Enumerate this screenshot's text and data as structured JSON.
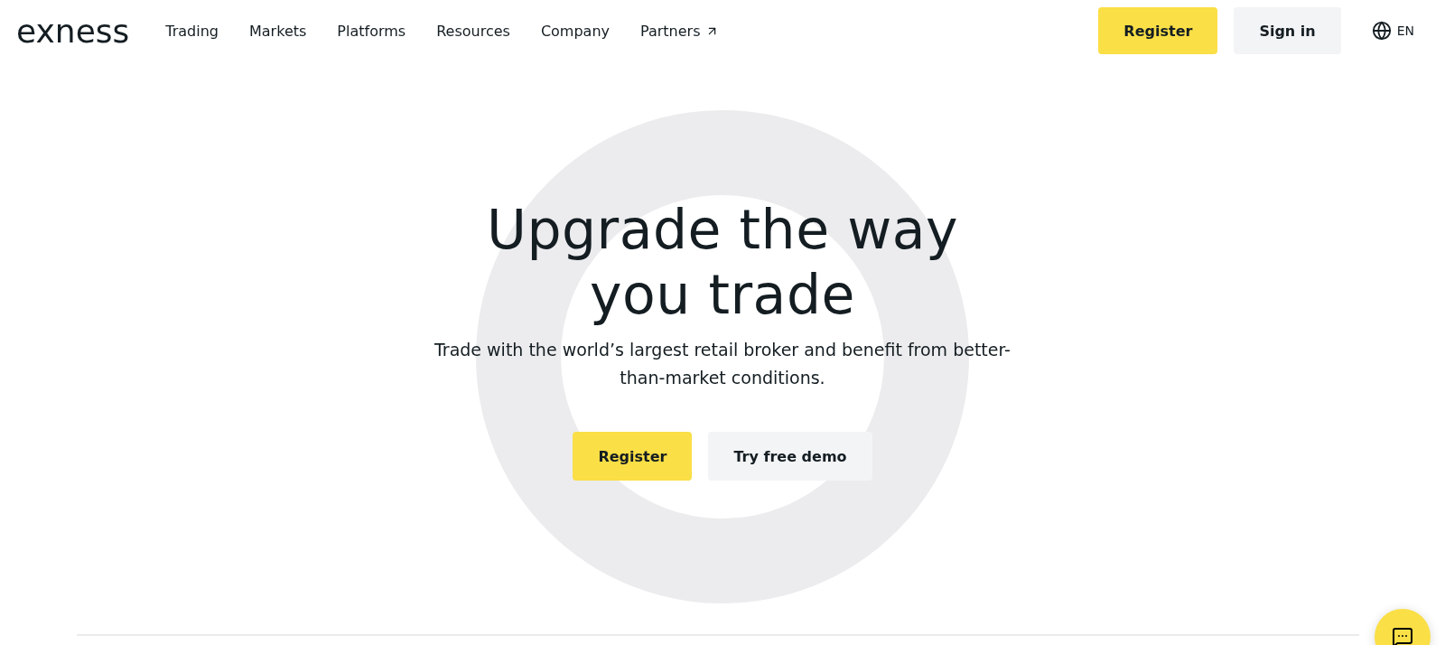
{
  "header": {
    "logo": "exness",
    "nav": [
      {
        "label": "Trading",
        "kind": "plain"
      },
      {
        "label": "Markets",
        "kind": "plain"
      },
      {
        "label": "Platforms",
        "kind": "plain"
      },
      {
        "label": "Resources",
        "kind": "plain"
      },
      {
        "label": "Company",
        "kind": "plain"
      },
      {
        "label": "Partners",
        "kind": "external"
      }
    ],
    "register": "Register",
    "sign_in": "Sign in",
    "language": "EN"
  },
  "hero": {
    "title": "Upgrade the way you trade",
    "subtitle": "Trade with the world’s largest retail broker and benefit from better-than-market conditions.",
    "primary": "Register",
    "secondary": "Try free demo"
  }
}
